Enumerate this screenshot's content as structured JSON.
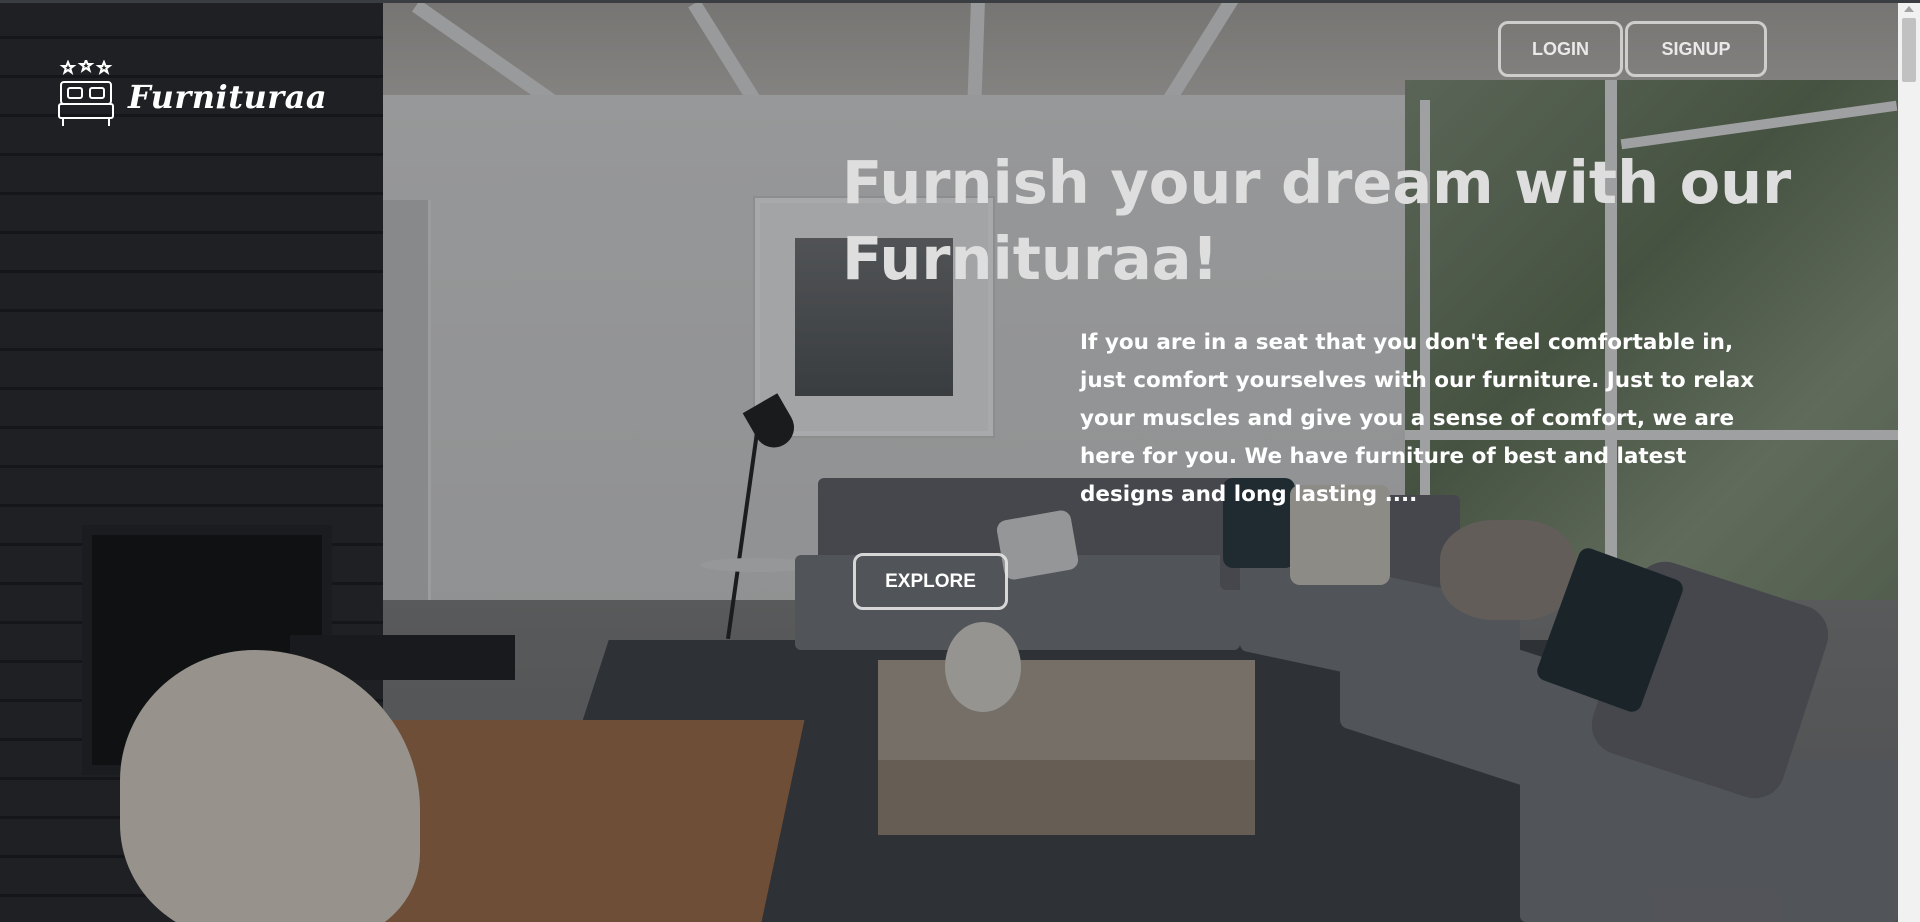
{
  "brand": {
    "name": "Furnituraa",
    "icon": "bed-with-stars-icon"
  },
  "nav": {
    "login_label": "LOGIN",
    "signup_label": "SIGNUP"
  },
  "hero": {
    "headline": "Furnish your dream with our Furnituraa!",
    "description": "If you are in a seat that you don't feel comfortable in, just comfort yourselves with our furniture. Just to relax your muscles and give you a sense of comfort, we are here for you. We have furniture of best and latest designs and long lasting ....",
    "explore_label": "EXPLORE"
  },
  "colors": {
    "overlay_text": "#ffffff",
    "headline_text": "#dedede",
    "button_border": "#dcdcdc"
  }
}
